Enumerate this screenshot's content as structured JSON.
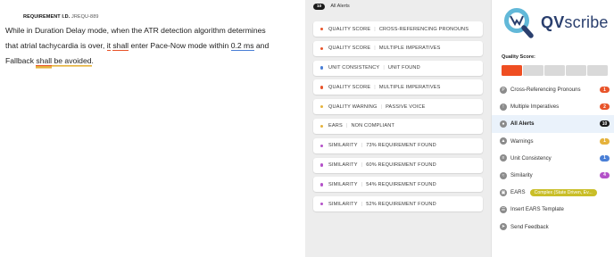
{
  "editor": {
    "req_id_label": "REQUIREMENT I.D.",
    "req_id_value": "JREQU-889",
    "text": {
      "l1": "While in Duration Delay mode, when the ATR detection algorithm determines",
      "l2a": "that atrial tachycardia is over, ",
      "it": "it",
      "sp1": " ",
      "shall1": "shall",
      "l2b": " enter Pace-Now mode within ",
      "num": "0.2 ms",
      "l2c": " and",
      "l3a": "Fallback ",
      "shall2": "shall",
      "l3b": " ",
      "be_avoided": "be avoided",
      "l3c": "."
    }
  },
  "alerts": {
    "count": "10",
    "label": "All Alerts",
    "items": [
      {
        "category": "QUALITY SCORE",
        "detail": "CROSS-REFERENCING PRONOUNS",
        "color": "#e8542a"
      },
      {
        "category": "QUALITY SCORE",
        "detail": "MULTIPLE IMPERATIVES",
        "color": "#e8542a"
      },
      {
        "category": "UNIT CONSISTENCY",
        "detail": "UNIT FOUND",
        "color": "#4a7fd6"
      },
      {
        "category": "QUALITY SCORE",
        "detail": "MULTIPLE IMPERATIVES",
        "color": "#e8542a"
      },
      {
        "category": "QUALITY WARNING",
        "detail": "PASSIVE VOICE",
        "color": "#e5b23c"
      },
      {
        "category": "EARS",
        "detail": "NON COMPLIANT",
        "color": "#e5b23c"
      },
      {
        "category": "SIMILARITY",
        "detail": "73% REQUIREMENT FOUND",
        "color": "#b452c9"
      },
      {
        "category": "SIMILARITY",
        "detail": "60% REQUIREMENT FOUND",
        "color": "#b452c9"
      },
      {
        "category": "SIMILARITY",
        "detail": "54% REQUIREMENT FOUND",
        "color": "#b452c9"
      },
      {
        "category": "SIMILARITY",
        "detail": "52% REQUIREMENT FOUND",
        "color": "#b452c9"
      }
    ]
  },
  "panel": {
    "logo": "QVscribe",
    "quality_score_label": "Quality Score:",
    "quality_score_segments": 5,
    "quality_score_filled": 1,
    "categories": [
      {
        "key": "cross-ref",
        "label": "Cross-Referencing Pronouns",
        "badge": "1",
        "badge_color": "#e8542a",
        "icon": "pronoun-icon"
      },
      {
        "key": "multi-imp",
        "label": "Multiple Imperatives",
        "badge": "2",
        "badge_color": "#e8542a",
        "icon": "imperative-icon"
      },
      {
        "key": "all",
        "label": "All Alerts",
        "badge": "10",
        "badge_color": "#1b1b1b",
        "icon": "bell-icon",
        "active": true
      },
      {
        "key": "warnings",
        "label": "Warnings",
        "badge": "1",
        "badge_color": "#e5b23c",
        "icon": "warning-icon"
      },
      {
        "key": "unit",
        "label": "Unit Consistency",
        "badge": "1",
        "badge_color": "#4a7fd6",
        "icon": "unit-icon"
      },
      {
        "key": "similarity",
        "label": "Similarity",
        "badge": "4",
        "badge_color": "#b452c9",
        "icon": "similarity-icon"
      },
      {
        "key": "ears",
        "label": "EARS",
        "tag": "Complex (State Driven, Ev...",
        "icon": "ears-icon"
      },
      {
        "key": "insert",
        "label": "Insert EARS Template",
        "icon": "template-icon"
      },
      {
        "key": "feedback",
        "label": "Send Feedback",
        "icon": "send-icon"
      }
    ]
  }
}
